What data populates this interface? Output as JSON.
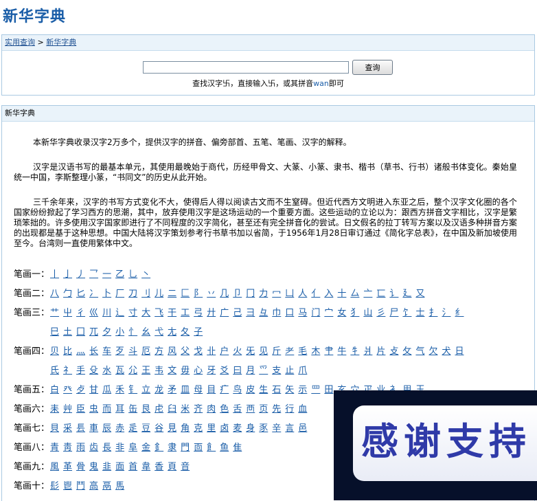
{
  "page_title": "新华字典",
  "breadcrumb": {
    "home": "实用查询",
    "separator": " > ",
    "current": "新华字典"
  },
  "search": {
    "input_value": "",
    "button_label": "查询",
    "hint_prefix": "查找汉字卐，直接输入卐，或其拼音",
    "hint_pinyin": "wan",
    "hint_suffix": "即可"
  },
  "dict_section_title": "新华字典",
  "paragraphs": [
    "本新华字典收录汉字2万多个，提供汉字的拼音、偏旁部首、五笔、笔画、汉字的解释。",
    "汉字是汉语书写的最基本单元，其使用最晚始于商代，历经甲骨文、大篆、小篆、隶书、楷书（草书、行书）诸般书体变化。秦始皇统一中国，李斯整理小篆，“书同文”的历史从此开始。",
    "三千余年来，汉字的书写方式变化不大，使得后人得以阅读古文而不生窒碍。但近代西方文明进入东亚之后，整个汉字文化圈的各个国家纷纷掀起了学习西方的思潮，其中，放弃使用汉字是这场运动的一个重要方面。这些运动的立论以为：跟西方拼音文字相比，汉字是繁琐笨拙的。许多使用汉字国家即进行了不同程度的汉字简化，甚至还有完全拼音化的尝试。日文假名的拉丁转写方案以及汉语多种拼音方案的出现都是基于这种思想。中国大陆将汉字策划参考行书草书加以省简，于1956年1月28日审订通过《简化字总表》，在中国及新加坡使用至今。台湾则一直使用繁体中文。"
  ],
  "stroke_rows": [
    {
      "label": "笔画一：",
      "radicals": [
        "丨",
        "亅",
        "丿",
        "乛",
        "一",
        "乙",
        "乚",
        "丶"
      ]
    },
    {
      "label": "笔画二：",
      "radicals": [
        "八",
        "勹",
        "匕",
        "冫",
        "卜",
        "厂",
        "刀",
        "刂",
        "儿",
        "二",
        "匚",
        "阝",
        "丷",
        "几",
        "卩",
        "冂",
        "力",
        "冖",
        "凵",
        "人",
        "亻",
        "入",
        "十",
        "厶",
        "亠",
        "匸",
        "讠",
        "廴",
        "又"
      ]
    },
    {
      "label": "笔画三：",
      "radicals": [
        "艹",
        "屮",
        "彳",
        "巛",
        "川",
        "辶",
        "寸",
        "大",
        "飞",
        "干",
        "工",
        "弓",
        "廾",
        "广",
        "己",
        "彐",
        "彑",
        "巾",
        "口",
        "马",
        "门",
        "宀",
        "女",
        "犭",
        "山",
        "彡",
        "尸",
        "饣",
        "士",
        "扌",
        "氵",
        "纟"
      ]
    },
    {
      "label": "",
      "radicals": [
        "巳",
        "土",
        "囗",
        "兀",
        "夕",
        "小",
        "忄",
        "幺",
        "弋",
        "尢",
        "夂",
        "子"
      ]
    },
    {
      "label": "笔画四：",
      "radicals": [
        "贝",
        "比",
        "灬",
        "长",
        "车",
        "歹",
        "斗",
        "厄",
        "方",
        "风",
        "父",
        "戈",
        "卝",
        "户",
        "火",
        "旡",
        "见",
        "斤",
        "耂",
        "毛",
        "木",
        "肀",
        "牛",
        "牜",
        "爿",
        "片",
        "攴",
        "攵",
        "气",
        "欠",
        "犬",
        "日"
      ]
    },
    {
      "label": "",
      "radicals": [
        "氏",
        "礻",
        "手",
        "殳",
        "水",
        "瓦",
        "尣",
        "王",
        "韦",
        "文",
        "毋",
        "心",
        "牙",
        "爻",
        "曰",
        "月",
        "爫",
        "支",
        "止",
        "爪"
      ]
    },
    {
      "label": "笔画五：",
      "radicals": [
        "白",
        "癶",
        "歺",
        "甘",
        "瓜",
        "禾",
        "钅",
        "立",
        "龙",
        "矛",
        "皿",
        "母",
        "目",
        "疒",
        "鸟",
        "皮",
        "生",
        "石",
        "矢",
        "示",
        "罒",
        "田",
        "玄",
        "穴",
        "疋",
        "业",
        "衤",
        "用",
        "玉"
      ]
    },
    {
      "label": "笔画六：",
      "radicals": [
        "耒",
        "艸",
        "臣",
        "虫",
        "而",
        "耳",
        "缶",
        "艮",
        "虍",
        "臼",
        "米",
        "齐",
        "肉",
        "色",
        "舌",
        "襾",
        "页",
        "先",
        "行",
        "血"
      ]
    },
    {
      "label": "笔画七：",
      "radicals": [
        "貝",
        "采",
        "镸",
        "車",
        "辰",
        "赤",
        "辵",
        "豆",
        "谷",
        "見",
        "角",
        "克",
        "里",
        "卤",
        "麦",
        "身",
        "豕",
        "辛",
        "言",
        "邑"
      ]
    },
    {
      "label": "笔画八：",
      "radicals": [
        "青",
        "靑",
        "雨",
        "齿",
        "長",
        "非",
        "阜",
        "金",
        "釒",
        "隶",
        "門",
        "靣",
        "飠",
        "鱼",
        "隹"
      ]
    },
    {
      "label": "笔画九：",
      "radicals": [
        "風",
        "革",
        "骨",
        "鬼",
        "韭",
        "面",
        "首",
        "韋",
        "香",
        "頁",
        "音"
      ]
    },
    {
      "label": "笔画十：",
      "radicals": [
        "髟",
        "鬯",
        "鬥",
        "高",
        "鬲",
        "馬"
      ]
    }
  ],
  "promo_text": "感谢支持",
  "colors": {
    "link": "#1b5ea8",
    "box_border": "#a9c9e2",
    "header_bg": "#eaf3fa"
  }
}
